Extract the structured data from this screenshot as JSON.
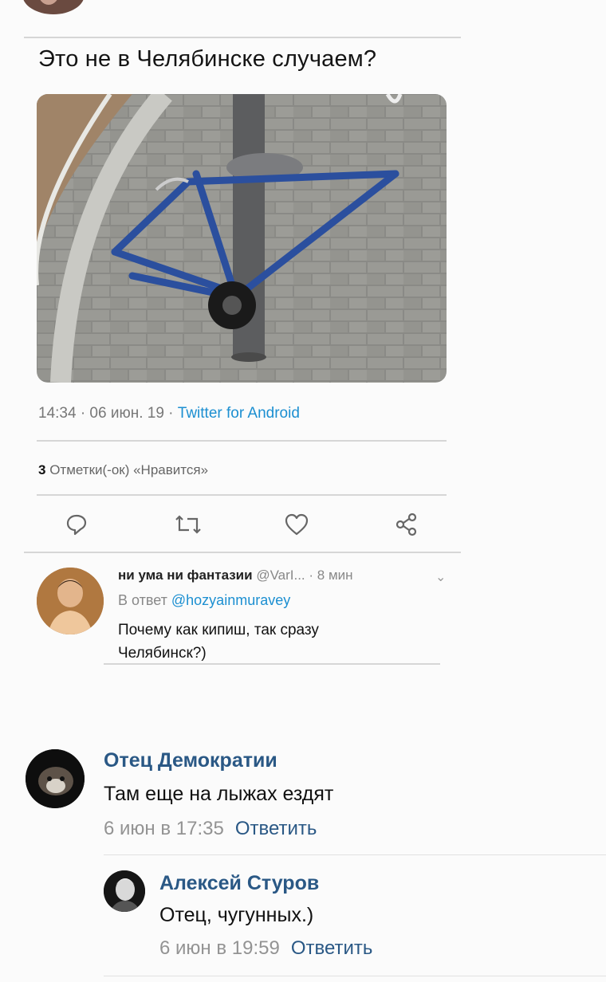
{
  "tweet": {
    "text": "Это не в Челябинске случаем?",
    "time": "14:34 · 06 июн. 19 · ",
    "source": "Twitter for Android",
    "likes_count": "3",
    "likes_label": " Отметки(-ок) «Нравится»",
    "actions": [
      "comment-icon",
      "retweet-icon",
      "heart-icon",
      "share-icon"
    ]
  },
  "reply": {
    "author": "ни ума ни фантазии",
    "handle": " @VarI...",
    "age": " · 8 мин",
    "in_reply_prefix": "В ответ ",
    "in_reply_handle": "@hozyainmuravey",
    "text": "Почему как кипиш, так сразу Челябинск?)"
  },
  "comments": [
    {
      "author": "Отец Демократии",
      "text": "Там еще на лыжах ездят",
      "date": "6 июн в 17:35",
      "reply_label": "Ответить"
    },
    {
      "author": "Алексей Стуров",
      "text": "Отец, чугунных.)",
      "date": "6 июн в 19:59",
      "reply_label": "Ответить"
    }
  ],
  "colors": {
    "twitter_link": "#1c8fd1",
    "vk_link": "#2a5885",
    "meta_gray": "#939393"
  }
}
